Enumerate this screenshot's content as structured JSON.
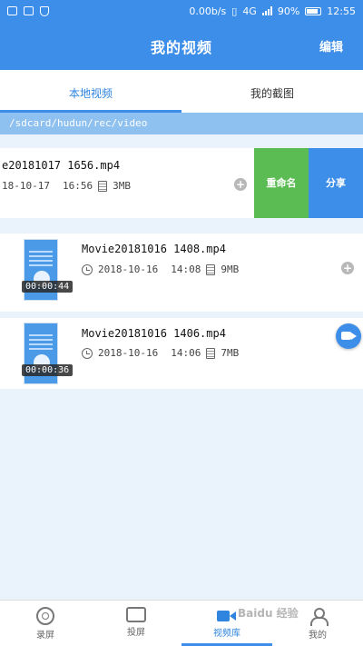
{
  "statusbar": {
    "speed": "0.00b/s",
    "network": "4G",
    "battery": "90%",
    "time": "12:55"
  },
  "header": {
    "title": "我的视频",
    "edit_label": "编辑"
  },
  "tabs": [
    {
      "label": "本地视频",
      "active": true
    },
    {
      "label": "我的截图",
      "active": false
    }
  ],
  "path": "/sdcard/hudun/rec/video",
  "videos": [
    {
      "filename": "e20181017 1656.mp4",
      "date": "18-10-17",
      "time": "16:56",
      "size": "3MB",
      "actions": {
        "rename": "重命名",
        "share": "分享"
      }
    },
    {
      "filename": "Movie20181016 1408.mp4",
      "date": "2018-10-16",
      "time": "14:08",
      "size": "9MB",
      "duration": "00:00:44"
    },
    {
      "filename": "Movie20181016 1406.mp4",
      "date": "2018-10-16",
      "time": "14:06",
      "size": "7MB",
      "duration": "00:00:36"
    }
  ],
  "bottom_nav": [
    {
      "label": "录屏",
      "icon": "record-icon",
      "active": false
    },
    {
      "label": "投屏",
      "icon": "cast-icon",
      "active": false
    },
    {
      "label": "视频库",
      "icon": "video-camera-icon",
      "active": true
    },
    {
      "label": "我的",
      "icon": "person-icon",
      "active": false
    }
  ],
  "watermark": "Baidu 经验",
  "colors": {
    "primary": "#3d8ee8",
    "rename": "#5cbc54",
    "path_bar": "#8ec0f0"
  }
}
